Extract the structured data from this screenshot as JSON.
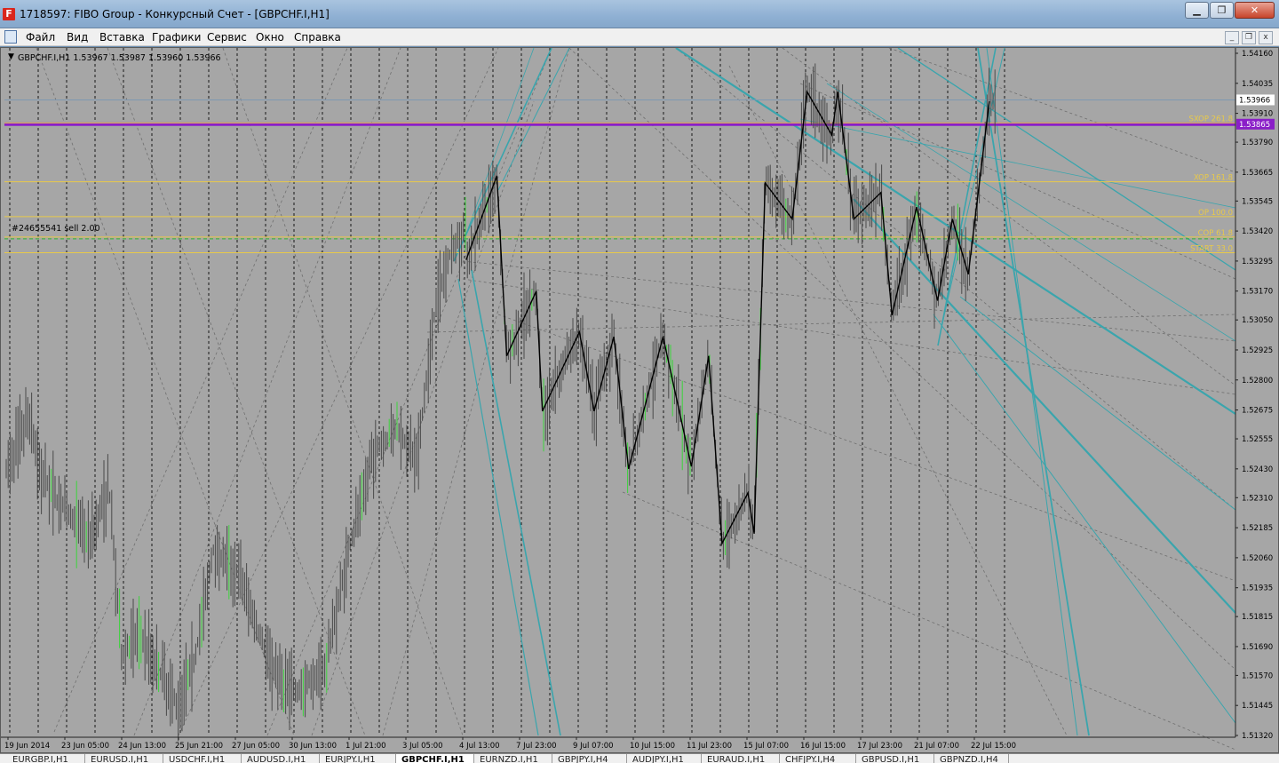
{
  "window": {
    "title": "1718597: FIBO Group - Конкурсный Счет - [GBPCHF.I,H1]",
    "app_icon_letter": "F"
  },
  "menu": {
    "items": [
      "Файл",
      "Вид",
      "Вставка",
      "Графики",
      "Сервис",
      "Окно",
      "Справка"
    ]
  },
  "chart_header": {
    "text": "GBPCHF.I,H1  1.53967 1.53987 1.53960 1.53966"
  },
  "order_label": "#24655541 sell 2.00",
  "current_price": "1.53966",
  "purple_level_price": "1.53865",
  "fib_levels": [
    {
      "label": "SXOP 261.8",
      "price": 1.5387,
      "color": "#e8c94a"
    },
    {
      "label": "XOP 161.8",
      "price": 1.53625,
      "color": "#e8c94a"
    },
    {
      "label": "OP 100.0",
      "price": 1.5348,
      "color": "#e8c94a"
    },
    {
      "label": "COP 61.8",
      "price": 1.53395,
      "color": "#e8c94a"
    },
    {
      "label": "START 33.0",
      "price": 1.5333,
      "color": "#e8c94a"
    }
  ],
  "chart_data": {
    "type": "candlestick",
    "symbol": "GBPCHF.I",
    "timeframe": "H1",
    "ylim": [
      1.5132,
      1.5416
    ],
    "y_ticks": [
      "1.54160",
      "1.54035",
      "1.53910",
      "1.53790",
      "1.53665",
      "1.53545",
      "1.53420",
      "1.53295",
      "1.53170",
      "1.53050",
      "1.52925",
      "1.52800",
      "1.52675",
      "1.52555",
      "1.52430",
      "1.52310",
      "1.52185",
      "1.52060",
      "1.51935",
      "1.51815",
      "1.51690",
      "1.51570",
      "1.51445",
      "1.51320"
    ],
    "x_tick_labels": [
      "19 Jun 2014",
      "23 Jun 05:00",
      "24 Jun 13:00",
      "25 Jun 21:00",
      "27 Jun 05:00",
      "30 Jun 13:00",
      "1 Jul 21:00",
      "3 Jul 05:00",
      "4 Jul 13:00",
      "7 Jul 23:00",
      "9 Jul 07:00",
      "10 Jul 15:00",
      "11 Jul 23:00",
      "15 Jul 07:00",
      "16 Jul 15:00",
      "17 Jul 23:00",
      "21 Jul 07:00",
      "22 Jul 15:00"
    ],
    "price_path": [
      {
        "t": 0.0,
        "p": 1.524
      },
      {
        "t": 0.02,
        "p": 1.5265
      },
      {
        "t": 0.03,
        "p": 1.524
      },
      {
        "t": 0.05,
        "p": 1.5225
      },
      {
        "t": 0.07,
        "p": 1.5215
      },
      {
        "t": 0.085,
        "p": 1.5235
      },
      {
        "t": 0.095,
        "p": 1.5165
      },
      {
        "t": 0.11,
        "p": 1.5175
      },
      {
        "t": 0.13,
        "p": 1.5155
      },
      {
        "t": 0.14,
        "p": 1.5145
      },
      {
        "t": 0.155,
        "p": 1.5165
      },
      {
        "t": 0.17,
        "p": 1.521
      },
      {
        "t": 0.19,
        "p": 1.52
      },
      {
        "t": 0.21,
        "p": 1.517
      },
      {
        "t": 0.225,
        "p": 1.5155
      },
      {
        "t": 0.24,
        "p": 1.515
      },
      {
        "t": 0.26,
        "p": 1.516
      },
      {
        "t": 0.28,
        "p": 1.521
      },
      {
        "t": 0.3,
        "p": 1.525
      },
      {
        "t": 0.32,
        "p": 1.526
      },
      {
        "t": 0.335,
        "p": 1.5245
      },
      {
        "t": 0.35,
        "p": 1.531
      },
      {
        "t": 0.36,
        "p": 1.533
      },
      {
        "t": 0.375,
        "p": 1.5345
      }
    ],
    "zigzag": [
      {
        "t": 0.375,
        "p": 1.533
      },
      {
        "t": 0.4,
        "p": 1.5365
      },
      {
        "t": 0.408,
        "p": 1.529
      },
      {
        "t": 0.432,
        "p": 1.5317
      },
      {
        "t": 0.437,
        "p": 1.5267
      },
      {
        "t": 0.467,
        "p": 1.53
      },
      {
        "t": 0.479,
        "p": 1.5267
      },
      {
        "t": 0.495,
        "p": 1.5298
      },
      {
        "t": 0.507,
        "p": 1.5243
      },
      {
        "t": 0.535,
        "p": 1.5298
      },
      {
        "t": 0.558,
        "p": 1.5244
      },
      {
        "t": 0.572,
        "p": 1.529
      },
      {
        "t": 0.583,
        "p": 1.5212
      },
      {
        "t": 0.604,
        "p": 1.5233
      },
      {
        "t": 0.609,
        "p": 1.5216
      },
      {
        "t": 0.618,
        "p": 1.5362
      },
      {
        "t": 0.64,
        "p": 1.5347
      },
      {
        "t": 0.652,
        "p": 1.54
      },
      {
        "t": 0.672,
        "p": 1.5382
      },
      {
        "t": 0.677,
        "p": 1.54
      },
      {
        "t": 0.69,
        "p": 1.5347
      },
      {
        "t": 0.712,
        "p": 1.5358
      },
      {
        "t": 0.721,
        "p": 1.5307
      },
      {
        "t": 0.741,
        "p": 1.5352
      },
      {
        "t": 0.758,
        "p": 1.5313
      },
      {
        "t": 0.77,
        "p": 1.5347
      },
      {
        "t": 0.783,
        "p": 1.5324
      },
      {
        "t": 0.8,
        "p": 1.5396
      }
    ]
  }
}
